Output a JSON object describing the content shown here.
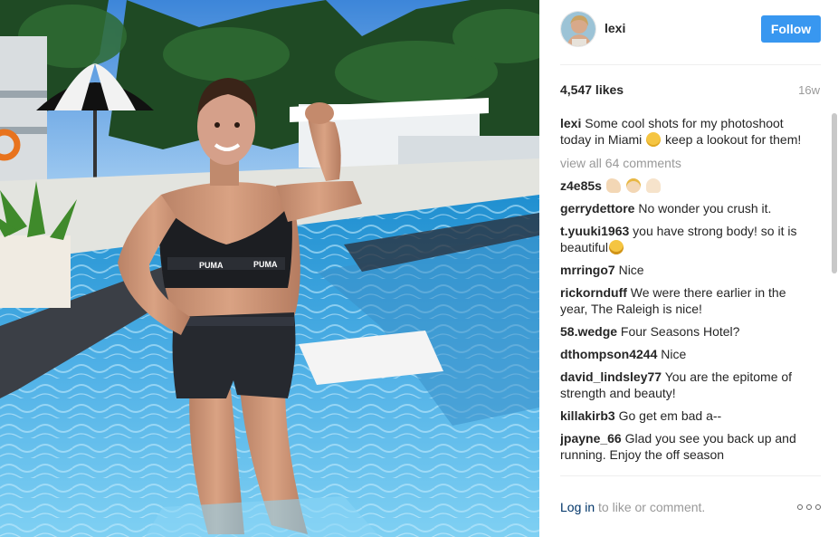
{
  "post": {
    "username": "lexi",
    "follow_label": "Follow",
    "likes": "4,547 likes",
    "time_ago": "16w"
  },
  "caption": {
    "user": "lexi",
    "text_before_emoji": "Some cool shots for my photoshoot today in Miami",
    "text_after_emoji": "keep a lookout for them!"
  },
  "view_all": "view all 64 comments",
  "comments": [
    {
      "user": "z4e85s",
      "text": ""
    },
    {
      "user": "gerrydettore",
      "text": "No wonder you crush it."
    },
    {
      "user": "t.yuuki1963",
      "text": "you have strong body! so it is beautiful"
    },
    {
      "user": "mrringo7",
      "text": "Nice"
    },
    {
      "user": "rickornduff",
      "text": "We were there earlier in the year, The Raleigh is nice!"
    },
    {
      "user": "58.wedge",
      "text": "Four Seasons Hotel?"
    },
    {
      "user": "dthompson4244",
      "text": "Nice"
    },
    {
      "user": "david_lindsley77",
      "text": "You are the epitome of strength and beauty!"
    },
    {
      "user": "killakirb3",
      "text": "Go get em bad a--"
    },
    {
      "user": "jpayne_66",
      "text": "Glad you see you back up and running. Enjoy the off season"
    }
  ],
  "footer": {
    "login_link": "Log in",
    "login_rest": "to like or comment."
  },
  "icons": {
    "avatar": "profile-avatar",
    "more": "more-options-icon"
  },
  "colors": {
    "follow_button": "#3897f0",
    "link": "#003569",
    "muted": "#999999",
    "text": "#262626"
  }
}
